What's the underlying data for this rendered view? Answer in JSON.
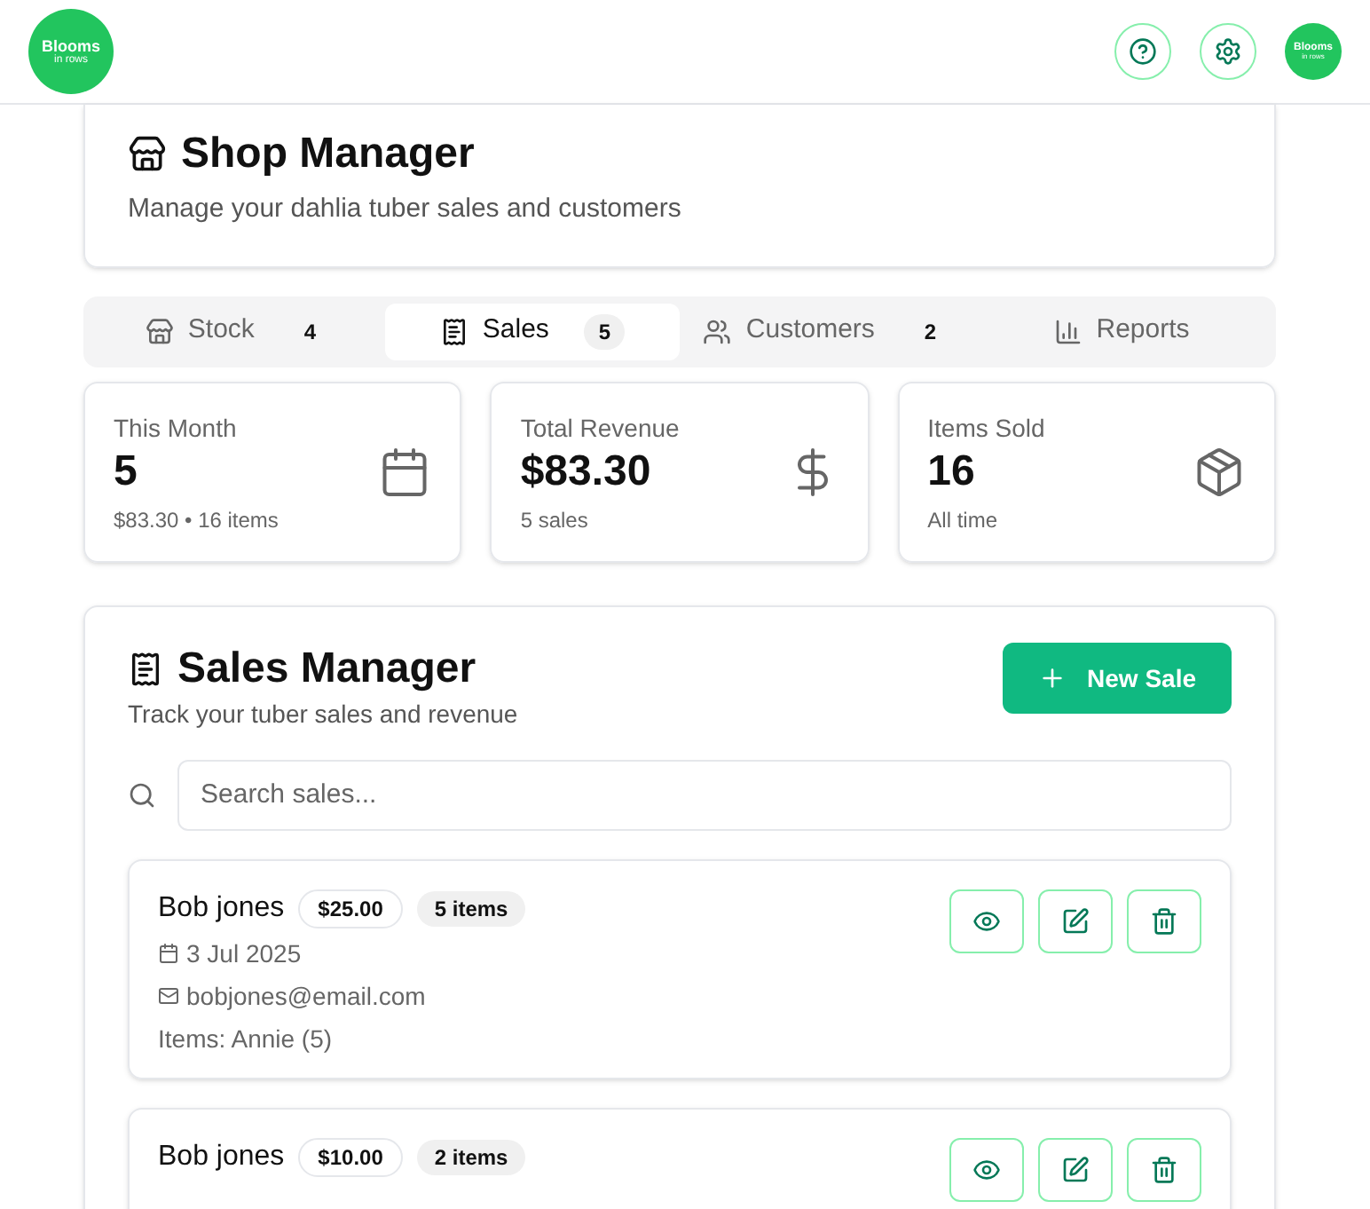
{
  "header": {
    "logo": {
      "line1": "Blooms",
      "line2": "in rows"
    },
    "avatar": {
      "line1": "Blooms",
      "line2": "in rows"
    }
  },
  "page": {
    "title": "Shop Manager",
    "subtitle": "Manage your dahlia tuber sales and customers"
  },
  "tabs": [
    {
      "kind": "stock",
      "label": "Stock",
      "count": "4",
      "selected": false
    },
    {
      "kind": "sales",
      "label": "Sales",
      "count": "5",
      "selected": true
    },
    {
      "kind": "customers",
      "label": "Customers",
      "count": "2",
      "selected": false
    },
    {
      "kind": "reports",
      "label": "Reports",
      "selected": false
    }
  ],
  "stats": [
    {
      "kind": "calendar",
      "label": "This Month",
      "value": "5",
      "note": "$83.30 • 16 items"
    },
    {
      "kind": "dollar",
      "label": "Total Revenue",
      "value": "$83.30",
      "note": "5 sales"
    },
    {
      "kind": "box",
      "label": "Items Sold",
      "value": "16",
      "note": "All time"
    }
  ],
  "sales_manager": {
    "title": "Sales Manager",
    "subtitle": "Track your tuber sales and revenue",
    "new_button": "New Sale",
    "search": {
      "placeholder": "Search sales..."
    },
    "sales": [
      {
        "customer": "Bob jones",
        "amount": "$25.00",
        "items_count": "5 items",
        "date": "3 Jul 2025",
        "email": "bobjones@email.com",
        "items": "Items: Annie (5)"
      },
      {
        "customer": "Bob jones",
        "amount": "$10.00",
        "items_count": "2 items"
      }
    ]
  }
}
